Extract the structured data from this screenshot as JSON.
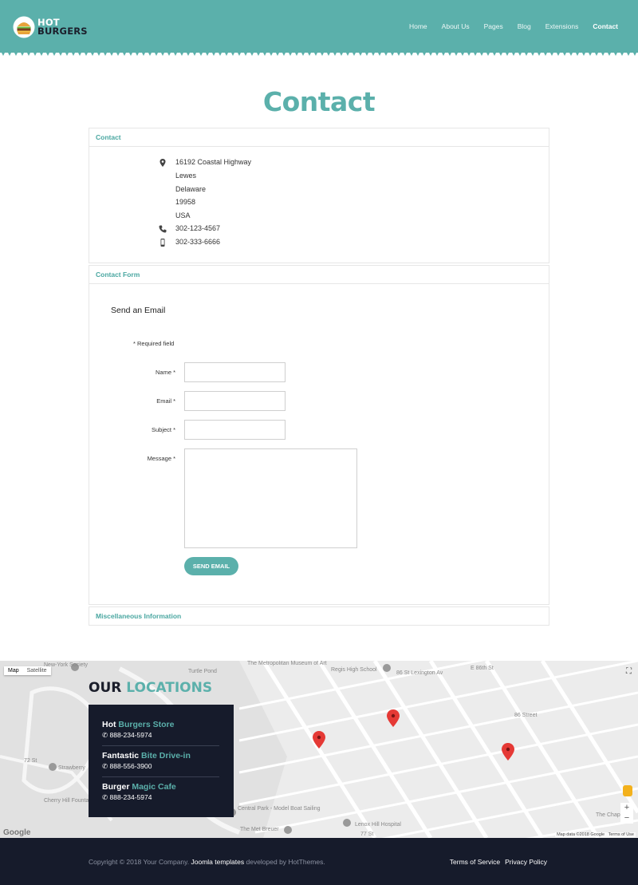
{
  "brand": {
    "line1": "HOT",
    "line2": "BURGERS"
  },
  "nav": [
    {
      "label": "Home"
    },
    {
      "label": "About Us"
    },
    {
      "label": "Pages"
    },
    {
      "label": "Blog"
    },
    {
      "label": "Extensions"
    },
    {
      "label": "Contact",
      "active": true
    }
  ],
  "page_title": "Contact",
  "contact": {
    "heading": "Contact",
    "address": [
      "16192 Coastal Highway",
      "Lewes",
      "Delaware",
      "19958",
      "USA"
    ],
    "phone": "302-123-4567",
    "mobile": "302-333-6666"
  },
  "form": {
    "heading": "Contact Form",
    "title": "Send an Email",
    "required_note": "* Required field",
    "name_label": "Name *",
    "email_label": "Email *",
    "subject_label": "Subject *",
    "message_label": "Message *",
    "submit_label": "SEND EMAIL"
  },
  "misc": {
    "heading": "Miscellaneous Information"
  },
  "map": {
    "type_map": "Map",
    "type_satellite": "Satellite",
    "attribution_data": "Map data ©2018 Google",
    "attribution_terms": "Terms of Use",
    "google": "Google",
    "labels": [
      "The Metropolitan Museum of Art",
      "Regis High School",
      "86 St Lexington Av",
      "86 Street",
      "Central Park - Model Boat Sailing",
      "Lenox Hill Hospital",
      "Cherry Hill Fountain",
      "Strawberry",
      "The Met Breuer",
      "Turtle Pond",
      "New-York Society",
      "The Chap",
      "E 86th St",
      "72 St",
      "77 St"
    ]
  },
  "locations": {
    "title_a": "OUR ",
    "title_b": "LOCATIONS",
    "items": [
      {
        "name_a": "Hot ",
        "name_b": "Burgers Store",
        "phone": "888-234-5974"
      },
      {
        "name_a": "Fantastic ",
        "name_b": "Bite Drive-in",
        "phone": "888-556-3900"
      },
      {
        "name_a": "Burger ",
        "name_b": "Magic Cafe",
        "phone": "888-234-5974"
      }
    ]
  },
  "footer": {
    "copyright_a": "Copyright © 2018 Your Company. ",
    "copyright_b": "Joomla templates",
    "copyright_c": " developed by HotThemes.",
    "terms": "Terms of Service",
    "privacy": "Privacy Policy"
  },
  "colors": {
    "accent": "#5bb0ab",
    "dark": "#161b2b",
    "pin": "#e53935"
  },
  "icons": [
    "burger-logo-icon",
    "map-marker-icon",
    "phone-icon",
    "mobile-icon",
    "fullscreen-icon",
    "pegman-icon"
  ]
}
